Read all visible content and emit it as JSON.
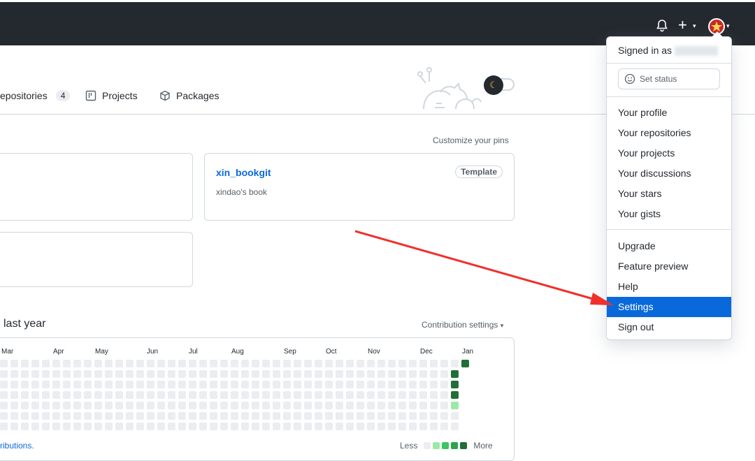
{
  "header": {
    "bell_icon": "bell-icon",
    "plus_label": "+",
    "caret": "▾",
    "avatar_icon": "red-star-avatar"
  },
  "tabs": [
    {
      "label": "epositories",
      "count": "4",
      "icon": "repo-icon"
    },
    {
      "label": "Projects",
      "icon": "project-icon"
    },
    {
      "label": "Packages",
      "icon": "package-icon"
    }
  ],
  "pins": {
    "customize_label": "Customize your pins",
    "repo": {
      "name": "xin_bookgit",
      "description": "xindao's book",
      "badge": "Template"
    }
  },
  "contributions": {
    "title": "last year",
    "settings_label": "Contribution settings",
    "months": [
      "Mar",
      "Apr",
      "May",
      "Jun",
      "Jul",
      "Aug",
      "Sep",
      "Oct",
      "Nov",
      "Dec",
      "Jan"
    ],
    "bottom_link": "ributions.",
    "legend_less": "Less",
    "legend_more": "More",
    "colors": [
      "#ebedf0",
      "#9be9a8",
      "#40c463",
      "#30a14e",
      "#216e39"
    ]
  },
  "dropdown": {
    "signed_in": "Signed in as",
    "set_status": "Set status",
    "group1": [
      "Your profile",
      "Your repositories",
      "Your projects",
      "Your discussions",
      "Your stars",
      "Your gists"
    ],
    "group2": [
      "Upgrade",
      "Feature preview",
      "Help",
      "Settings",
      "Sign out"
    ],
    "active_item": "Settings",
    "accent_color": "#0969da"
  },
  "annotation": {
    "arrow_color": "#f0302b"
  }
}
